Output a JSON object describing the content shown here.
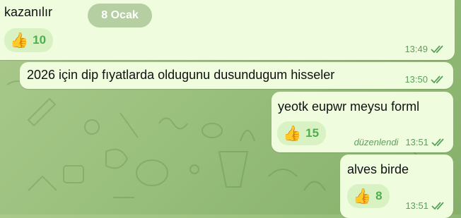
{
  "chat": {
    "date_label": "8 Ocak",
    "messages": [
      {
        "text": "kazanılır",
        "reaction_icon": "thumbs-up",
        "reaction_count": "10",
        "time": "13:49"
      },
      {
        "text": "2026 için dip fıyatlarda oldugunu dusundugum hisseler",
        "time": "13:50"
      },
      {
        "text": "yeotk eupwr meysu forml",
        "reaction_icon": "thumbs-up",
        "reaction_count": "15",
        "edited": "düzenlendi",
        "time": "13:51"
      },
      {
        "text": "alves birde",
        "reaction_icon": "thumbs-up",
        "reaction_count": "8",
        "time": "13:51"
      }
    ],
    "colors": {
      "bubble": "#effdde",
      "reaction_bg": "#d9f2c4",
      "accent_green": "#4fae4e",
      "background": "#9cc17f"
    }
  }
}
